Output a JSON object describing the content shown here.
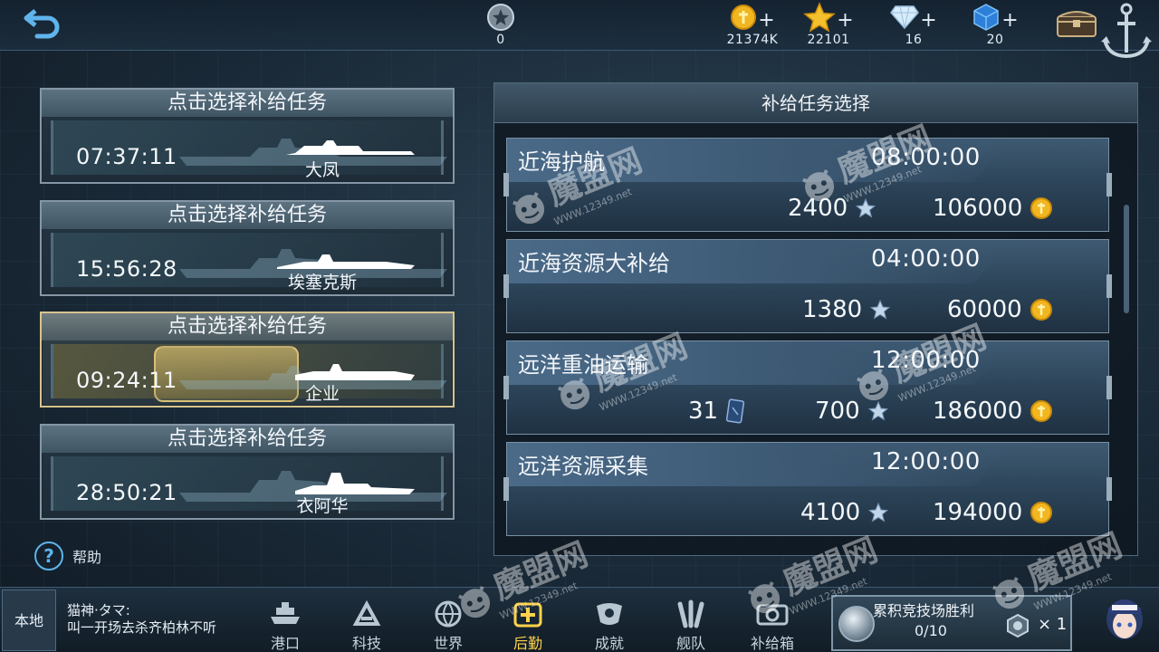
{
  "top_bar": {
    "back_icon": "back-arrow-icon",
    "resources": [
      {
        "name": "medal",
        "icon": "star-medal-icon",
        "value": "0",
        "has_plus": false
      },
      {
        "name": "gold",
        "icon": "gold-coin-icon",
        "value": "21374K",
        "has_plus": true
      },
      {
        "name": "star",
        "icon": "gold-star-icon",
        "value": "22101",
        "has_plus": true
      },
      {
        "name": "diamond",
        "icon": "diamond-icon",
        "value": "16",
        "has_plus": true
      },
      {
        "name": "cube",
        "icon": "blue-cube-icon",
        "value": "20",
        "has_plus": true
      }
    ],
    "plus_label": "+"
  },
  "tasks": [
    {
      "title": "点击选择补给任务",
      "time": "07:37:11",
      "ship": "大凤",
      "active": false
    },
    {
      "title": "点击选择补给任务",
      "time": "15:56:28",
      "ship": "埃塞克斯",
      "active": false
    },
    {
      "title": "点击选择补给任务",
      "time": "09:24:11",
      "ship": "企业",
      "active": true
    },
    {
      "title": "点击选择补给任务",
      "time": "28:50:21",
      "ship": "衣阿华",
      "active": false
    }
  ],
  "help": {
    "icon_text": "?",
    "label": "帮助"
  },
  "panel": {
    "title": "补给任务选择",
    "items": [
      {
        "name": "近海护航",
        "duration": "08:00:00",
        "card": null,
        "stars": "2400",
        "gold": "106000"
      },
      {
        "name": "近海资源大补给",
        "duration": "04:00:00",
        "card": null,
        "stars": "1380",
        "gold": "60000"
      },
      {
        "name": "远洋重油运输",
        "duration": "12:00:00",
        "card": "31",
        "stars": "700",
        "gold": "186000"
      },
      {
        "name": "远洋资源采集",
        "duration": "12:00:00",
        "card": null,
        "stars": "4100",
        "gold": "194000"
      }
    ]
  },
  "bottom_bar": {
    "local_label": "本地",
    "chat_user": "猫神·タマ:",
    "chat_message": "叫一开场去杀齐柏林不听",
    "nav": [
      {
        "label": "港口",
        "icon": "harbor-icon",
        "active": false
      },
      {
        "label": "科技",
        "icon": "tech-icon",
        "active": false
      },
      {
        "label": "世界",
        "icon": "world-icon",
        "active": false
      },
      {
        "label": "后勤",
        "icon": "logistics-icon",
        "active": true
      },
      {
        "label": "成就",
        "icon": "achievement-icon",
        "active": false
      },
      {
        "label": "舰队",
        "icon": "fleet-icon",
        "active": false
      },
      {
        "label": "补给箱",
        "icon": "supply-box-icon",
        "active": false
      }
    ],
    "arena": {
      "title": "累积竞技场胜利",
      "progress": "0/10",
      "count": "× 1"
    }
  },
  "watermark": {
    "brand": "魔盟网",
    "site": "WWW.12349.net"
  },
  "colors": {
    "accent_gold": "#ffd24a",
    "help_blue": "#5fb4ec",
    "active_border": "#d7c48b"
  }
}
